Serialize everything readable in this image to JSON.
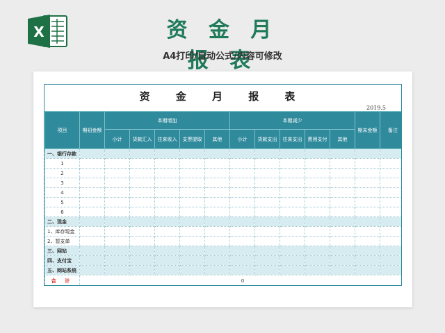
{
  "banner": {
    "title": "资 金 月 报 表",
    "subtitle": "A4打印/自动公式/内容可修改",
    "logo_letter": "X",
    "logo_color": "#1e7145",
    "title_color": "#1f7a5a"
  },
  "sheet": {
    "title": "资 金 月 报 表",
    "date": "2019.5",
    "header_color": "#2f8a9c",
    "section_color": "#d6ecf1",
    "headers": {
      "item": "项目",
      "opening": "期初金额",
      "increase_group": "本期增加",
      "decrease_group": "本期减少",
      "closing": "期末金额",
      "remark": "备注",
      "increase_cols": [
        "小计",
        "货款汇入",
        "往来收入",
        "支票提取",
        "其他"
      ],
      "decrease_cols": [
        "小计",
        "货款支出",
        "往来支出",
        "费用支付",
        "其他"
      ]
    },
    "rows": [
      {
        "label": "一、银行存款",
        "type": "section"
      },
      {
        "label": "1",
        "type": "num"
      },
      {
        "label": "2",
        "type": "num"
      },
      {
        "label": "3",
        "type": "num"
      },
      {
        "label": "4",
        "type": "num"
      },
      {
        "label": "5",
        "type": "num"
      },
      {
        "label": "6",
        "type": "num"
      },
      {
        "label": "二、现金",
        "type": "section"
      },
      {
        "label": "1、库存现金",
        "type": "sub"
      },
      {
        "label": "2、暂支单",
        "type": "sub"
      },
      {
        "label": "三、网站",
        "type": "section"
      },
      {
        "label": "四、支付宝",
        "type": "section"
      },
      {
        "label": "五、网站系统",
        "type": "section"
      }
    ],
    "total": {
      "label": "合 计",
      "value": "0",
      "label_color": "#d9261c"
    }
  }
}
